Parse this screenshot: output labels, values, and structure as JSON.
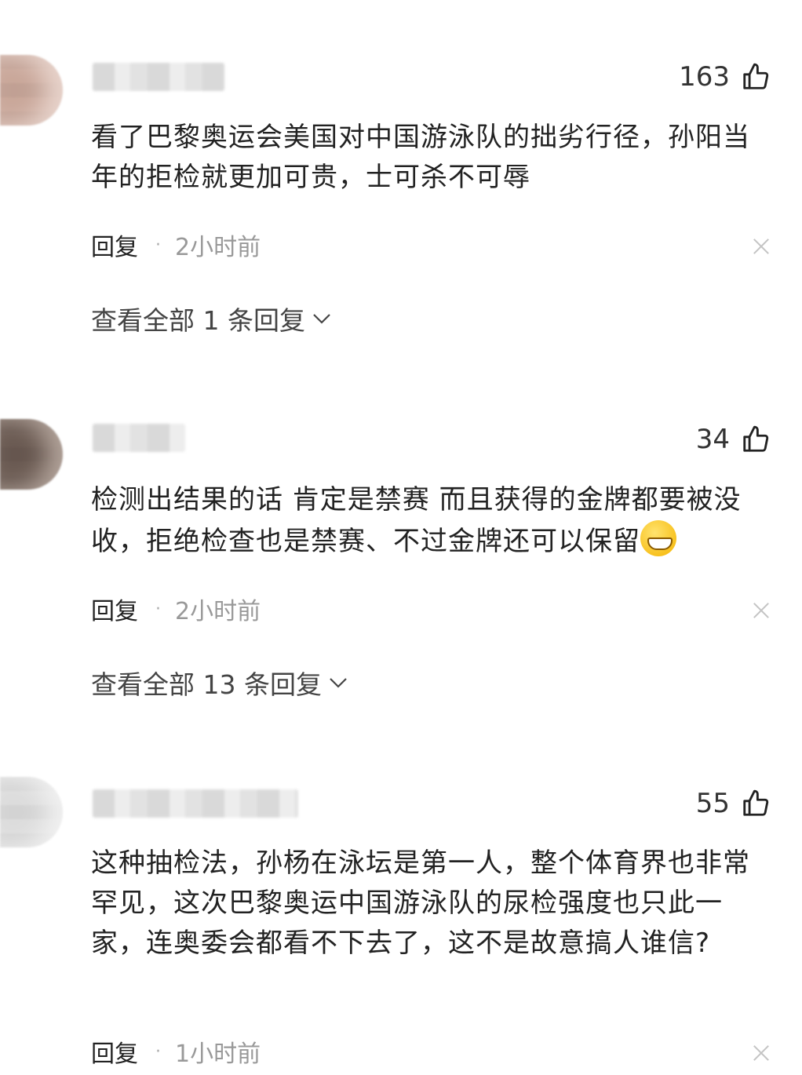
{
  "comments": [
    {
      "likes": "163",
      "text": "看了巴黎奥运会美国对中国游泳队的拙劣行径，孙阳当年的拒检就更加可贵，士可杀不可辱",
      "reply_label": "回复",
      "time": "2小时前",
      "view_replies": "查看全部 1 条回复"
    },
    {
      "likes": "34",
      "text": "检测出结果的话 肯定是禁赛 而且获得的金牌都要被没收，拒绝检查也是禁赛、不过金牌还可以保留",
      "reply_label": "回复",
      "time": "2小时前",
      "view_replies": "查看全部 13 条回复"
    },
    {
      "likes": "55",
      "text": "这种抽检法，孙杨在泳坛是第一人，整个体育界也非常罕见，这次巴黎奥运中国游泳队的尿检强度也只此一家，连奥委会都看不下去了，这不是故意搞人谁信?",
      "reply_label": "回复",
      "time": "1小时前"
    }
  ],
  "separator": "·",
  "icons": {
    "like": "thumbs-up-icon",
    "close": "close-icon",
    "expand": "chevron-down-icon",
    "emoji": "grinning-face-emoji"
  },
  "colors": {
    "text": "#222222",
    "meta": "#999999",
    "close": "#c4c4c4"
  }
}
